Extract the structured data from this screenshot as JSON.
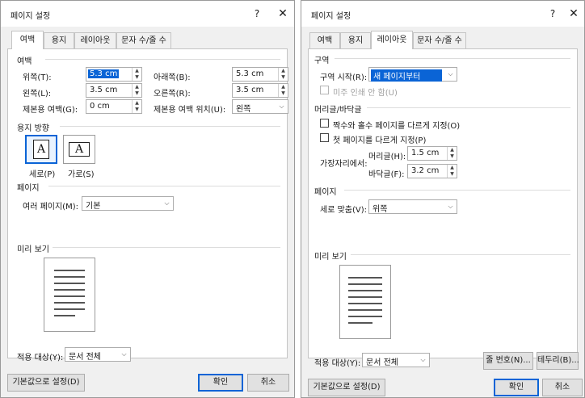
{
  "left_dialog": {
    "title": "페이지 설정",
    "help": "?",
    "close": "✕",
    "tabs": [
      "여백",
      "용지",
      "레이아웃",
      "문자 수/줄 수"
    ],
    "margins": {
      "section": "여백",
      "top_label": "위쪽(T):",
      "top_value": "5.3 cm",
      "bottom_label": "아래쪽(B):",
      "bottom_value": "5.3 cm",
      "left_label": "왼쪽(L):",
      "left_value": "3.5 cm",
      "right_label": "오른쪽(R):",
      "right_value": "3.5 cm",
      "gutter_label": "제본용 여백(G):",
      "gutter_value": "0 cm",
      "gutter_pos_label": "제본용 여백 위치(U):",
      "gutter_pos_value": "왼쪽"
    },
    "orientation": {
      "section": "용지 방향",
      "portrait_label": "세로(P)",
      "landscape_label": "가로(S)",
      "glyph": "A"
    },
    "pages": {
      "section": "페이지",
      "multiple_label": "여러 페이지(M):",
      "multiple_value": "기본"
    },
    "preview": {
      "section": "미리 보기"
    },
    "apply": {
      "label": "적용 대상(Y):",
      "value": "문서 전체"
    },
    "buttons": {
      "default": "기본값으로 설정(D)",
      "ok": "확인",
      "cancel": "취소"
    }
  },
  "right_dialog": {
    "title": "페이지 설정",
    "help": "?",
    "close": "✕",
    "tabs": [
      "여백",
      "용지",
      "레이아웃",
      "문자 수/줄 수"
    ],
    "section": {
      "title": "구역",
      "start_label": "구역 시작(R):",
      "start_value": "새 페이지부터",
      "suppress_label": "미주 인쇄 안 함(U)"
    },
    "headers": {
      "title": "머리글/바닥글",
      "odd_even_label": "짝수와 홀수 페이지를 다르게 지정(O)",
      "first_page_label": "첫 페이지를 다르게 지정(P)",
      "from_edge_label": "가장자리에서:",
      "header_label": "머리글(H):",
      "header_value": "1.5 cm",
      "footer_label": "바닥글(F):",
      "footer_value": "3.2 cm"
    },
    "page": {
      "title": "페이지",
      "vertical_label": "세로 맞춤(V):",
      "vertical_value": "위쪽"
    },
    "preview": {
      "section": "미리 보기"
    },
    "apply": {
      "label": "적용 대상(Y):",
      "value": "문서 전체"
    },
    "buttons": {
      "line_numbers": "줄 번호(N)...",
      "borders": "테두리(B)...",
      "default": "기본값으로 설정(D)",
      "ok": "확인",
      "cancel": "취소"
    }
  }
}
